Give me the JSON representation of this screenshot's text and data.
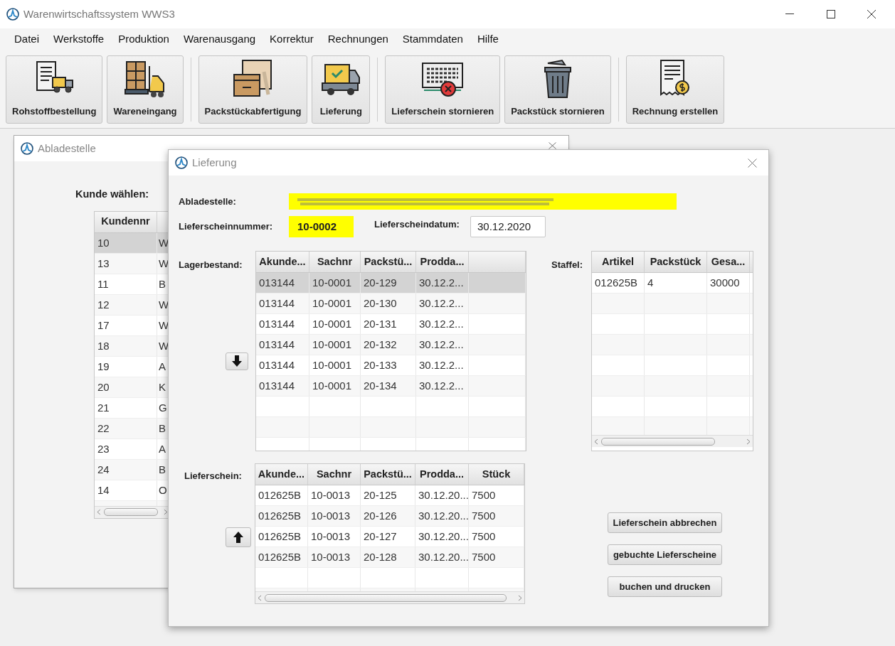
{
  "window": {
    "title": "Warenwirtschaftssystem WWS3"
  },
  "menu": [
    "Datei",
    "Werkstoffe",
    "Produktion",
    "Warenausgang",
    "Korrektur",
    "Rechnungen",
    "Stammdaten",
    "Hilfe"
  ],
  "toolbar": [
    {
      "label": "Rohstoffbestellung",
      "kind": "order"
    },
    {
      "label": "Wareneingang",
      "kind": "forklift"
    },
    {
      "label": "Packstückabfertigung",
      "kind": "boxes"
    },
    {
      "label": "Lieferung",
      "kind": "truck"
    },
    {
      "label": "Lieferschein stornieren",
      "kind": "cancel"
    },
    {
      "label": "Packstück stornieren",
      "kind": "trash"
    },
    {
      "label": "Rechnung erstellen",
      "kind": "invoice"
    }
  ],
  "abladestelle_dialog": {
    "title": "Abladestelle",
    "prompt": "Kunde wählen:",
    "table": {
      "columns": [
        "Kundennr"
      ],
      "rows": [
        {
          "cells": [
            "10",
            "W"
          ],
          "selected": true
        },
        {
          "cells": [
            "13",
            "W"
          ],
          "selected": false
        },
        {
          "cells": [
            "11",
            "B"
          ],
          "selected": false
        },
        {
          "cells": [
            "12",
            "W"
          ],
          "selected": false
        },
        {
          "cells": [
            "17",
            "W"
          ],
          "selected": false
        },
        {
          "cells": [
            "18",
            "W"
          ],
          "selected": false
        },
        {
          "cells": [
            "19",
            "A"
          ],
          "selected": false
        },
        {
          "cells": [
            "20",
            "K"
          ],
          "selected": false
        },
        {
          "cells": [
            "21",
            "G"
          ],
          "selected": false
        },
        {
          "cells": [
            "22",
            "B"
          ],
          "selected": false
        },
        {
          "cells": [
            "23",
            "A"
          ],
          "selected": false
        },
        {
          "cells": [
            "24",
            "B"
          ],
          "selected": false
        },
        {
          "cells": [
            "14",
            "O"
          ],
          "selected": false
        }
      ]
    }
  },
  "lieferung_dialog": {
    "title": "Lieferung",
    "abladestelle_label": "Abladestelle:",
    "lieferscheinnummer_label": "Lieferscheinnummer:",
    "lieferscheinnummer": "10-0002",
    "lieferscheindatum_label": "Lieferscheindatum:",
    "lieferscheindatum": "30.12.2020",
    "lagerbestand": {
      "label": "Lagerbestand:",
      "columns": [
        "Akunde...",
        "Sachnr",
        "Packstü...",
        "Prodda..."
      ],
      "rows": [
        {
          "cells": [
            "013144",
            "10-0001",
            "20-129",
            "30.12.2..."
          ],
          "selected": true
        },
        {
          "cells": [
            "013144",
            "10-0001",
            "20-130",
            "30.12.2..."
          ],
          "selected": false
        },
        {
          "cells": [
            "013144",
            "10-0001",
            "20-131",
            "30.12.2..."
          ],
          "selected": false
        },
        {
          "cells": [
            "013144",
            "10-0001",
            "20-132",
            "30.12.2..."
          ],
          "selected": false
        },
        {
          "cells": [
            "013144",
            "10-0001",
            "20-133",
            "30.12.2..."
          ],
          "selected": false
        },
        {
          "cells": [
            "013144",
            "10-0001",
            "20-134",
            "30.12.2..."
          ],
          "selected": false
        }
      ]
    },
    "staffel": {
      "label": "Staffel:",
      "columns": [
        "Artikel",
        "Packstück",
        "Gesa..."
      ],
      "rows": [
        {
          "cells": [
            "012625B",
            "4",
            "30000"
          ],
          "selected": false
        }
      ]
    },
    "lieferschein": {
      "label": "Lieferschein:",
      "columns": [
        "Akunde...",
        "Sachnr",
        "Packstü...",
        "Prodda...",
        "Stück"
      ],
      "rows": [
        {
          "cells": [
            "012625B",
            "10-0013",
            "20-125",
            "30.12.20...",
            "7500"
          ],
          "selected": false
        },
        {
          "cells": [
            "012625B",
            "10-0013",
            "20-126",
            "30.12.20...",
            "7500"
          ],
          "selected": false
        },
        {
          "cells": [
            "012625B",
            "10-0013",
            "20-127",
            "30.12.20...",
            "7500"
          ],
          "selected": false
        },
        {
          "cells": [
            "012625B",
            "10-0013",
            "20-128",
            "30.12.20...",
            "7500"
          ],
          "selected": false
        }
      ]
    },
    "buttons": [
      "Lieferschein abbrechen",
      "gebuchte Lieferscheine",
      "buchen und drucken"
    ]
  }
}
